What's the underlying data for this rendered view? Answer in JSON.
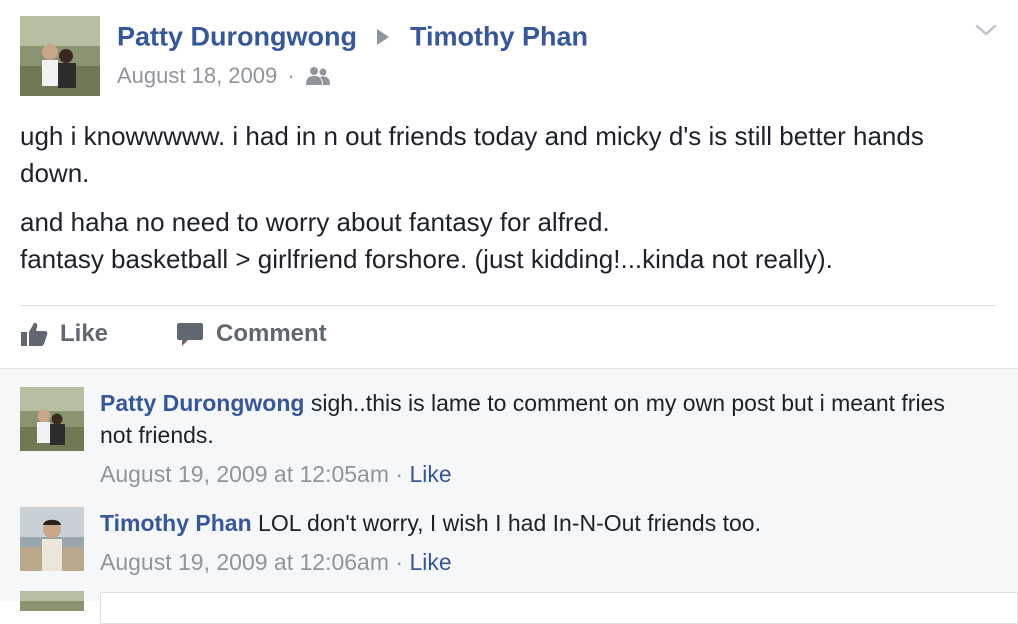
{
  "post": {
    "author": "Patty Durongwong",
    "recipient": "Timothy Phan",
    "date": "August 18, 2009",
    "separator": "·",
    "audience_icon": "friends-icon",
    "menu_icon": "chevron-down-icon",
    "paragraphs": [
      "ugh i knowwwww. i had in n out friends today and micky d's is still better hands down.",
      "and haha no need to worry about fantasy for alfred.",
      "fantasy basketball > girlfriend forshore. (just kidding!...kinda not really)."
    ]
  },
  "actions": {
    "like_label": "Like",
    "comment_label": "Comment"
  },
  "comments": [
    {
      "author": "Patty Durongwong",
      "text": "sigh..this is lame to comment on my own post but i meant fries not friends.",
      "timestamp": "August 19, 2009 at 12:05am",
      "separator": "·",
      "like_label": "Like"
    },
    {
      "author": "Timothy Phan",
      "text": "LOL don't worry, I wish I had In-N-Out friends too.",
      "timestamp": "August 19, 2009 at 12:06am",
      "separator": "·",
      "like_label": "Like"
    }
  ],
  "colors": {
    "link": "#365899",
    "meta": "#90949c",
    "text": "#1d2129",
    "comments_bg": "#f6f7f9"
  }
}
